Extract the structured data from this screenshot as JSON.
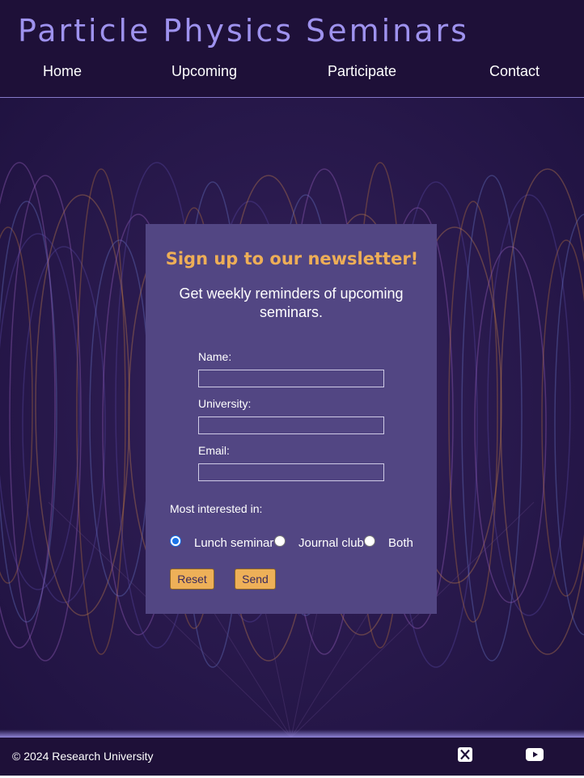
{
  "header": {
    "title": "Particle Physics Seminars",
    "nav": [
      "Home",
      "Upcoming",
      "Participate",
      "Contact"
    ]
  },
  "newsletter": {
    "title": "Sign up to our newsletter!",
    "subtitle": "Get weekly reminders of upcoming seminars.",
    "fields": [
      {
        "label": "Name:",
        "value": ""
      },
      {
        "label": "University:",
        "value": ""
      },
      {
        "label": "Email:",
        "value": ""
      }
    ],
    "interest_label": "Most interested in:",
    "options": [
      {
        "label": "Lunch seminar",
        "checked": true
      },
      {
        "label": "Journal club",
        "checked": false
      },
      {
        "label": "Both",
        "checked": false
      }
    ],
    "reset_label": "Reset",
    "send_label": "Send"
  },
  "footer": {
    "copyright": "© 2024 Research University",
    "social": [
      "x-icon",
      "youtube-icon"
    ]
  },
  "colors": {
    "header_bg": "#1e1038",
    "title": "#9e92ee",
    "card_bg": "#524683",
    "accent": "#eeae57"
  }
}
